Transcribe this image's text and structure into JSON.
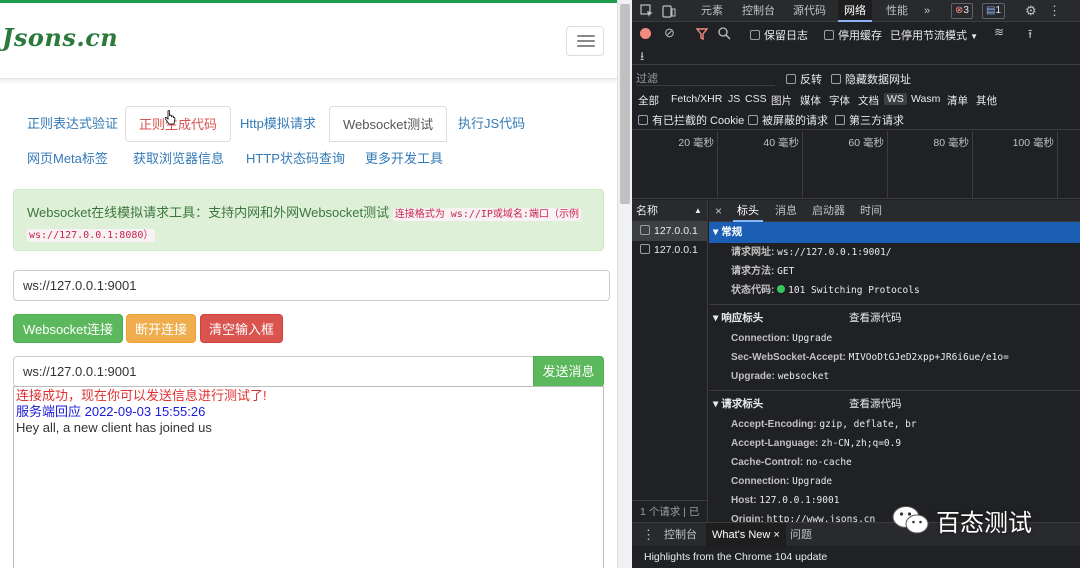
{
  "page": {
    "brand": "Jsons.cn",
    "tabs_row1": [
      {
        "label": "正则表达式验证"
      },
      {
        "label": "正则生成代码"
      },
      {
        "label": "Http模拟请求"
      },
      {
        "label": "Websocket测试"
      },
      {
        "label": "执行JS代码"
      }
    ],
    "tabs_row2": [
      {
        "label": "网页Meta标签"
      },
      {
        "label": "获取浏览器信息"
      },
      {
        "label": "HTTP状态码查询"
      },
      {
        "label": "更多开发工具"
      }
    ],
    "alert_text": "Websocket在线模拟请求工具：支持内网和外网Websocket测试",
    "alert_code_1": "连接格式为 ws://IP或域名:端口（示例",
    "alert_code_2": "ws://127.0.0.1:8080）",
    "url_value": "ws://127.0.0.1:9001",
    "btn_connect": "Websocket连接",
    "btn_disconnect": "断开连接",
    "btn_clear": "清空输入框",
    "msg_value": "ws://127.0.0.1:9001",
    "btn_send": "发送消息",
    "log": {
      "connected": "连接成功，现在你可以发送信息进行测试了!",
      "server_reply": "服务端回应 2022-09-03 15:55:26",
      "message": "Hey all, a new client has joined us"
    }
  },
  "devtools": {
    "tabs": [
      "元素",
      "控制台",
      "源代码",
      "网络",
      "性能"
    ],
    "more_tabs": "»",
    "errors_count": "3",
    "messages_count": "1",
    "toolbar": {
      "preserve_log": "保留日志",
      "disable_cache": "停用缓存",
      "throttling": "已停用节流模式"
    },
    "filter": {
      "placeholder": "过滤",
      "invert": "反转",
      "hide_data_urls": "隐藏数据网址",
      "types": [
        "全部",
        "Fetch/XHR",
        "JS",
        "CSS",
        "图片",
        "媒体",
        "字体",
        "文档",
        "WS",
        "Wasm",
        "清单",
        "其他"
      ],
      "blocked_cookies": "有已拦截的 Cookie",
      "blocked_requests": "被屏蔽的请求",
      "third_party": "第三方请求"
    },
    "timeline": [
      "20 毫秒",
      "40 毫秒",
      "60 毫秒",
      "80 毫秒",
      "100 毫秒"
    ],
    "names_header": "名称",
    "requests": [
      "127.0.0.1",
      "127.0.0.1"
    ],
    "names_footer": "1 个请求 | 已",
    "detail_tabs": [
      "标头",
      "消息",
      "启动器",
      "时间"
    ],
    "general": {
      "title": "常规",
      "request_url_k": "请求网址:",
      "request_url_v": "ws://127.0.0.1:9001/",
      "method_k": "请求方法:",
      "method_v": "GET",
      "status_k": "状态代码:",
      "status_v": "101 Switching Protocols"
    },
    "response_headers": {
      "title": "响应标头",
      "view_source": "查看源代码",
      "rows": [
        {
          "k": "Connection:",
          "v": "Upgrade"
        },
        {
          "k": "Sec-WebSocket-Accept:",
          "v": "MIVOoDtGJeD2xpp+JR6i6ue/e1o="
        },
        {
          "k": "Upgrade:",
          "v": "websocket"
        }
      ]
    },
    "request_headers": {
      "title": "请求标头",
      "view_source": "查看源代码",
      "rows": [
        {
          "k": "Accept-Encoding:",
          "v": "gzip, deflate, br"
        },
        {
          "k": "Accept-Language:",
          "v": "zh-CN,zh;q=0.9"
        },
        {
          "k": "Cache-Control:",
          "v": "no-cache"
        },
        {
          "k": "Connection:",
          "v": "Upgrade"
        },
        {
          "k": "Host:",
          "v": "127.0.0.1:9001"
        },
        {
          "k": "Origin:",
          "v": "http://www.jsons.cn"
        }
      ]
    },
    "drawer_tabs": [
      "控制台",
      "What's New",
      "问题"
    ],
    "status_text": "Highlights from the Chrome 104 update"
  },
  "watermark": "百态测试",
  "colors": {
    "brand_green": "#2c7a3b",
    "link_blue": "#337ab7",
    "success_green": "#5cb85c",
    "warning_orange": "#f0ad4e",
    "danger_red": "#d9534f",
    "devtools_bg": "#202124",
    "selected_blue": "#1a5fb4"
  }
}
